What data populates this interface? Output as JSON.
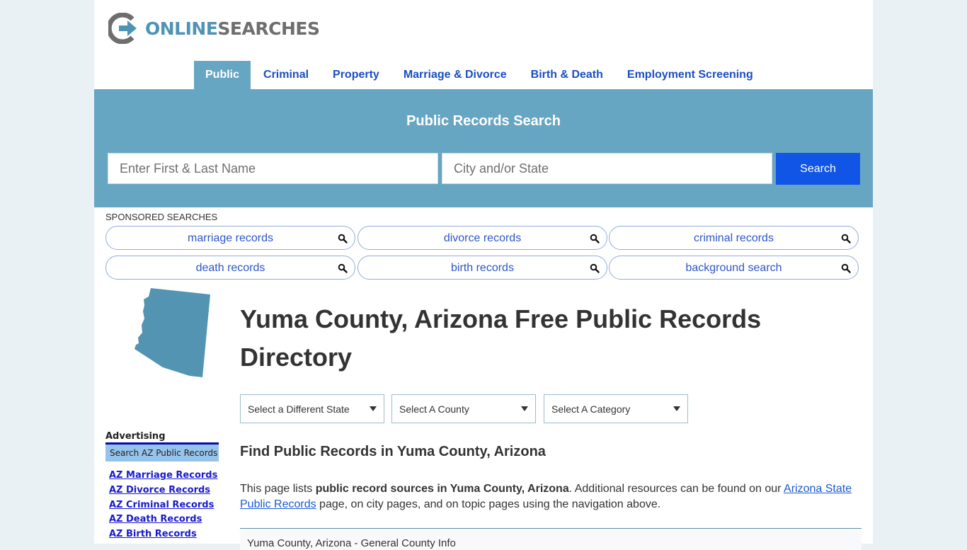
{
  "logo": {
    "online": "ONLINE",
    "searches": "SEARCHES",
    "icon": "arrow-circle-logo-icon"
  },
  "nav": {
    "items": [
      {
        "label": "Public",
        "active": true
      },
      {
        "label": "Criminal"
      },
      {
        "label": "Property"
      },
      {
        "label": "Marriage & Divorce"
      },
      {
        "label": "Birth & Death"
      },
      {
        "label": "Employment Screening"
      }
    ]
  },
  "hero": {
    "title": "Public Records Search",
    "name_placeholder": "Enter First & Last Name",
    "name_value": "",
    "city_placeholder": "City and/or State",
    "city_value": "",
    "search_label": "Search"
  },
  "sponsored": {
    "label": "SPONSORED SEARCHES",
    "items": [
      {
        "label": "marriage records",
        "icon": "search-icon"
      },
      {
        "label": "divorce records",
        "icon": "search-icon"
      },
      {
        "label": "criminal records",
        "icon": "search-icon"
      },
      {
        "label": "death records",
        "icon": "search-icon"
      },
      {
        "label": "birth records",
        "icon": "search-icon"
      },
      {
        "label": "background search",
        "icon": "search-icon"
      }
    ]
  },
  "sidebar": {
    "map_icon": "arizona-state-map-icon",
    "advertising_label": "Advertising",
    "box_title": "Search AZ Public Records",
    "links": [
      "AZ Marriage Records",
      "AZ Divorce Records",
      "AZ Criminal Records",
      "AZ Death Records",
      "AZ Birth Records"
    ]
  },
  "main": {
    "title": "Yuma County, Arizona Free Public Records Directory",
    "selects": [
      {
        "value": "Select a Different State"
      },
      {
        "value": "Select A County"
      },
      {
        "value": "Select A Category"
      }
    ],
    "subtitle": "Find Public Records in Yuma County, Arizona",
    "intro": {
      "prefix": "This page lists ",
      "bold": "public record sources in Yuma County, Arizona",
      "middle": ". Additional resources can be found on our ",
      "link": "Arizona State Public Records",
      "suffix": " page, on city pages, and on topic pages using the navigation above."
    },
    "info_header": "Yuma County, Arizona - General County Info"
  },
  "colors": {
    "brand_blue": "#67a6c2",
    "nav_link": "#1a4fc4",
    "search_button": "#1155e6",
    "page_background": "#e9f1f5"
  }
}
